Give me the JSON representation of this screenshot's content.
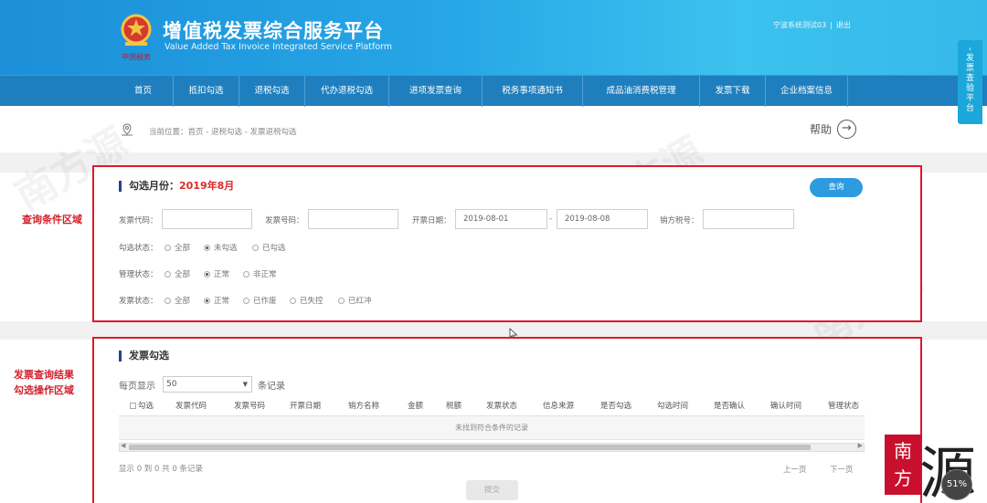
{
  "header": {
    "title": "增值税发票综合服务平台",
    "subtitle": "Value Added Tax Invoice Integrated Service Platform",
    "logo_text": "中国税务",
    "user_name": "宁波系统测试03",
    "logout": "退出"
  },
  "nav": {
    "items": [
      "首页",
      "抵扣勾选",
      "退税勾选",
      "代办退税勾选",
      "进项发票查询",
      "税务事项通知书",
      "成品油消费税管理",
      "发票下载",
      "企业档案信息"
    ]
  },
  "side_tab": {
    "label": "发票查验平台"
  },
  "breadcrumb": {
    "text": "当前位置：首页 - 退税勾选 - 发票退税勾选",
    "help": "帮助"
  },
  "side_labels": {
    "query_area": "查询条件区域",
    "result_area_1": "发票查询结果",
    "result_area_2": "勾选操作区域"
  },
  "query": {
    "title": "勾选月份：",
    "month": "2019年8月",
    "button": "查询",
    "fields": {
      "invoice_code": {
        "label": "发票代码：",
        "value": ""
      },
      "invoice_number": {
        "label": "发票号码：",
        "value": ""
      },
      "issue_date": {
        "label": "开票日期：",
        "from": "2019-08-01",
        "to": "2019-08-08"
      },
      "seller_tax_id": {
        "label": "销方税号：",
        "value": ""
      }
    },
    "check_status": {
      "label": "勾选状态：",
      "options": [
        "全部",
        "未勾选",
        "已勾选"
      ],
      "selected": "未勾选"
    },
    "manage_status": {
      "label": "管理状态：",
      "options": [
        "全部",
        "正常",
        "非正常"
      ],
      "selected": "正常"
    },
    "invoice_status": {
      "label": "发票状态：",
      "options": [
        "全部",
        "正常",
        "已作废",
        "已失控",
        "已红冲"
      ],
      "selected": "正常"
    }
  },
  "results": {
    "title": "发票勾选",
    "per_page_label": "每页显示",
    "per_page_value": "50",
    "per_page_suffix": "条记录",
    "columns": [
      "勾选",
      "发票代码",
      "发票号码",
      "开票日期",
      "销方名称",
      "金额",
      "税额",
      "发票状态",
      "信息来源",
      "是否勾选",
      "勾选时间",
      "是否确认",
      "确认时间",
      "管理状态"
    ],
    "empty_text": "未找到符合条件的记录",
    "summary": "显示 0 到 0 共 0 条记录",
    "prev": "上一页",
    "next": "下一页",
    "submit": "提交"
  },
  "watermark": "南方源",
  "brand": {
    "box_text_1": "南",
    "box_text_2": "方",
    "big_char": "源"
  },
  "video_badge": "51%"
}
